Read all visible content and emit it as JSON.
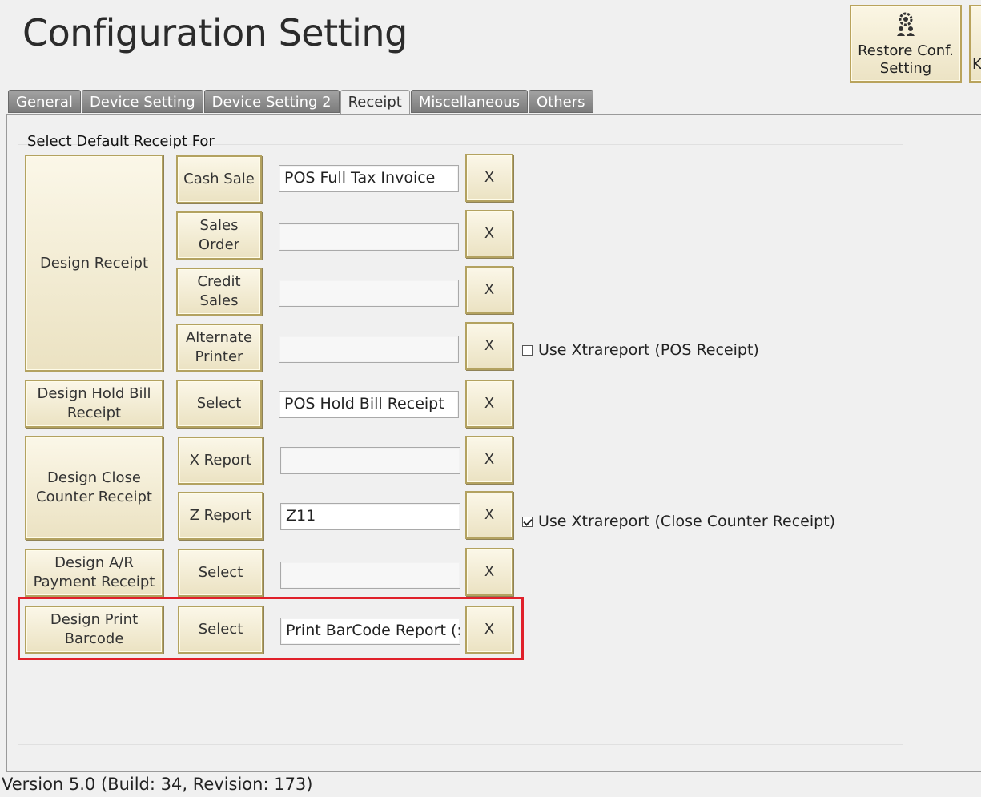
{
  "title": "Configuration Setting",
  "top_buttons": [
    {
      "label": "Restore Conf. Setting",
      "icon": "gear-people-icon"
    },
    {
      "label": "K"
    }
  ],
  "tabs": [
    "General",
    "Device Setting",
    "Device Setting 2",
    "Receipt",
    "Miscellaneous",
    "Others"
  ],
  "active_tab": "Receipt",
  "group_label": "Select Default Receipt For",
  "design_buttons": {
    "receipt": "Design Receipt",
    "hold_bill": "Design Hold Bill Receipt",
    "close_counter": "Design Close Counter Receipt",
    "ar_payment": "Design A/R Payment Receipt",
    "print_barcode": "Design Print Barcode"
  },
  "rows": [
    {
      "label": "Cash Sale",
      "value": "POS Full Tax Invoice",
      "clear": "X"
    },
    {
      "label": "Sales Order",
      "value": "",
      "clear": "X"
    },
    {
      "label": "Credit Sales",
      "value": "",
      "clear": "X"
    },
    {
      "label": "Alternate Printer",
      "value": "",
      "clear": "X"
    },
    {
      "label": "Select",
      "value": "POS Hold Bill Receipt",
      "clear": "X"
    },
    {
      "label": "X Report",
      "value": "",
      "clear": "X"
    },
    {
      "label": "Z Report",
      "value": "Z11",
      "clear": "X"
    },
    {
      "label": "Select",
      "value": "",
      "clear": "X"
    },
    {
      "label": "Select",
      "value": "Print BarCode Report (:",
      "clear": "X"
    }
  ],
  "checkboxes": [
    {
      "label": "Use Xtrareport (POS Receipt)",
      "checked": false
    },
    {
      "label": "Use Xtrareport (Close Counter Receipt)",
      "checked": true
    }
  ],
  "version": "Version 5.0 (Build: 34, Revision: 173)",
  "colors": {
    "button_face": "#f5efd6",
    "button_border": "#b3a260",
    "highlight": "#e0202a",
    "tab_inactive": "#8e8e8e"
  }
}
